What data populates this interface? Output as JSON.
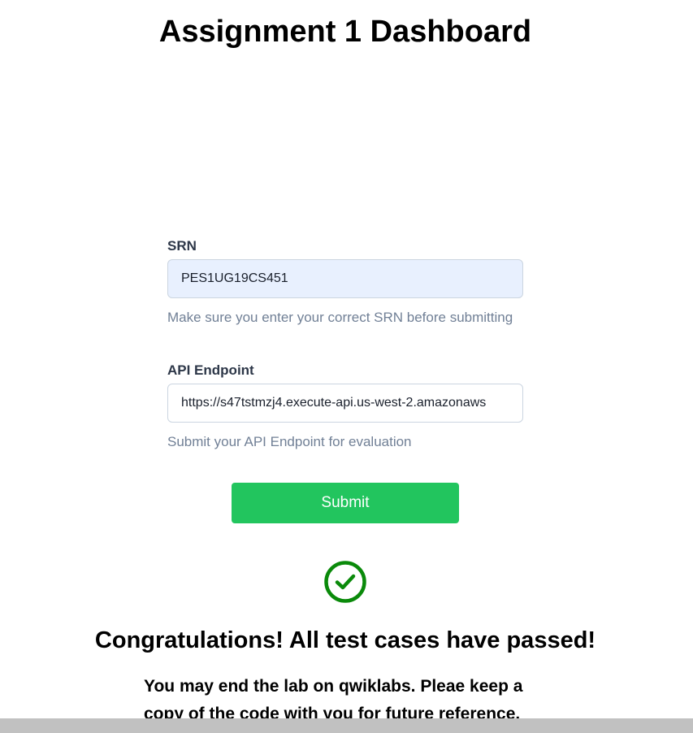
{
  "page": {
    "title": "Assignment 1 Dashboard"
  },
  "form": {
    "srn": {
      "label": "SRN",
      "value": "PES1UG19CS451",
      "help": "Make sure you enter your correct SRN before submitting"
    },
    "api_endpoint": {
      "label": "API Endpoint",
      "value": "https://s47tstmzj4.execute-api.us-west-2.amazonaws",
      "help": "Submit your API Endpoint for evaluation"
    },
    "submit_label": "Submit"
  },
  "result": {
    "icon": "check-circle-icon",
    "heading": "Congratulations! All test cases have passed!",
    "message": "You may end the lab on qwiklabs. Pleae keep a copy of the code with you for future reference."
  },
  "colors": {
    "submit_bg": "#22c55e",
    "success_icon": "#0a8a0a",
    "input_autofill_bg": "#e8f0fe"
  }
}
